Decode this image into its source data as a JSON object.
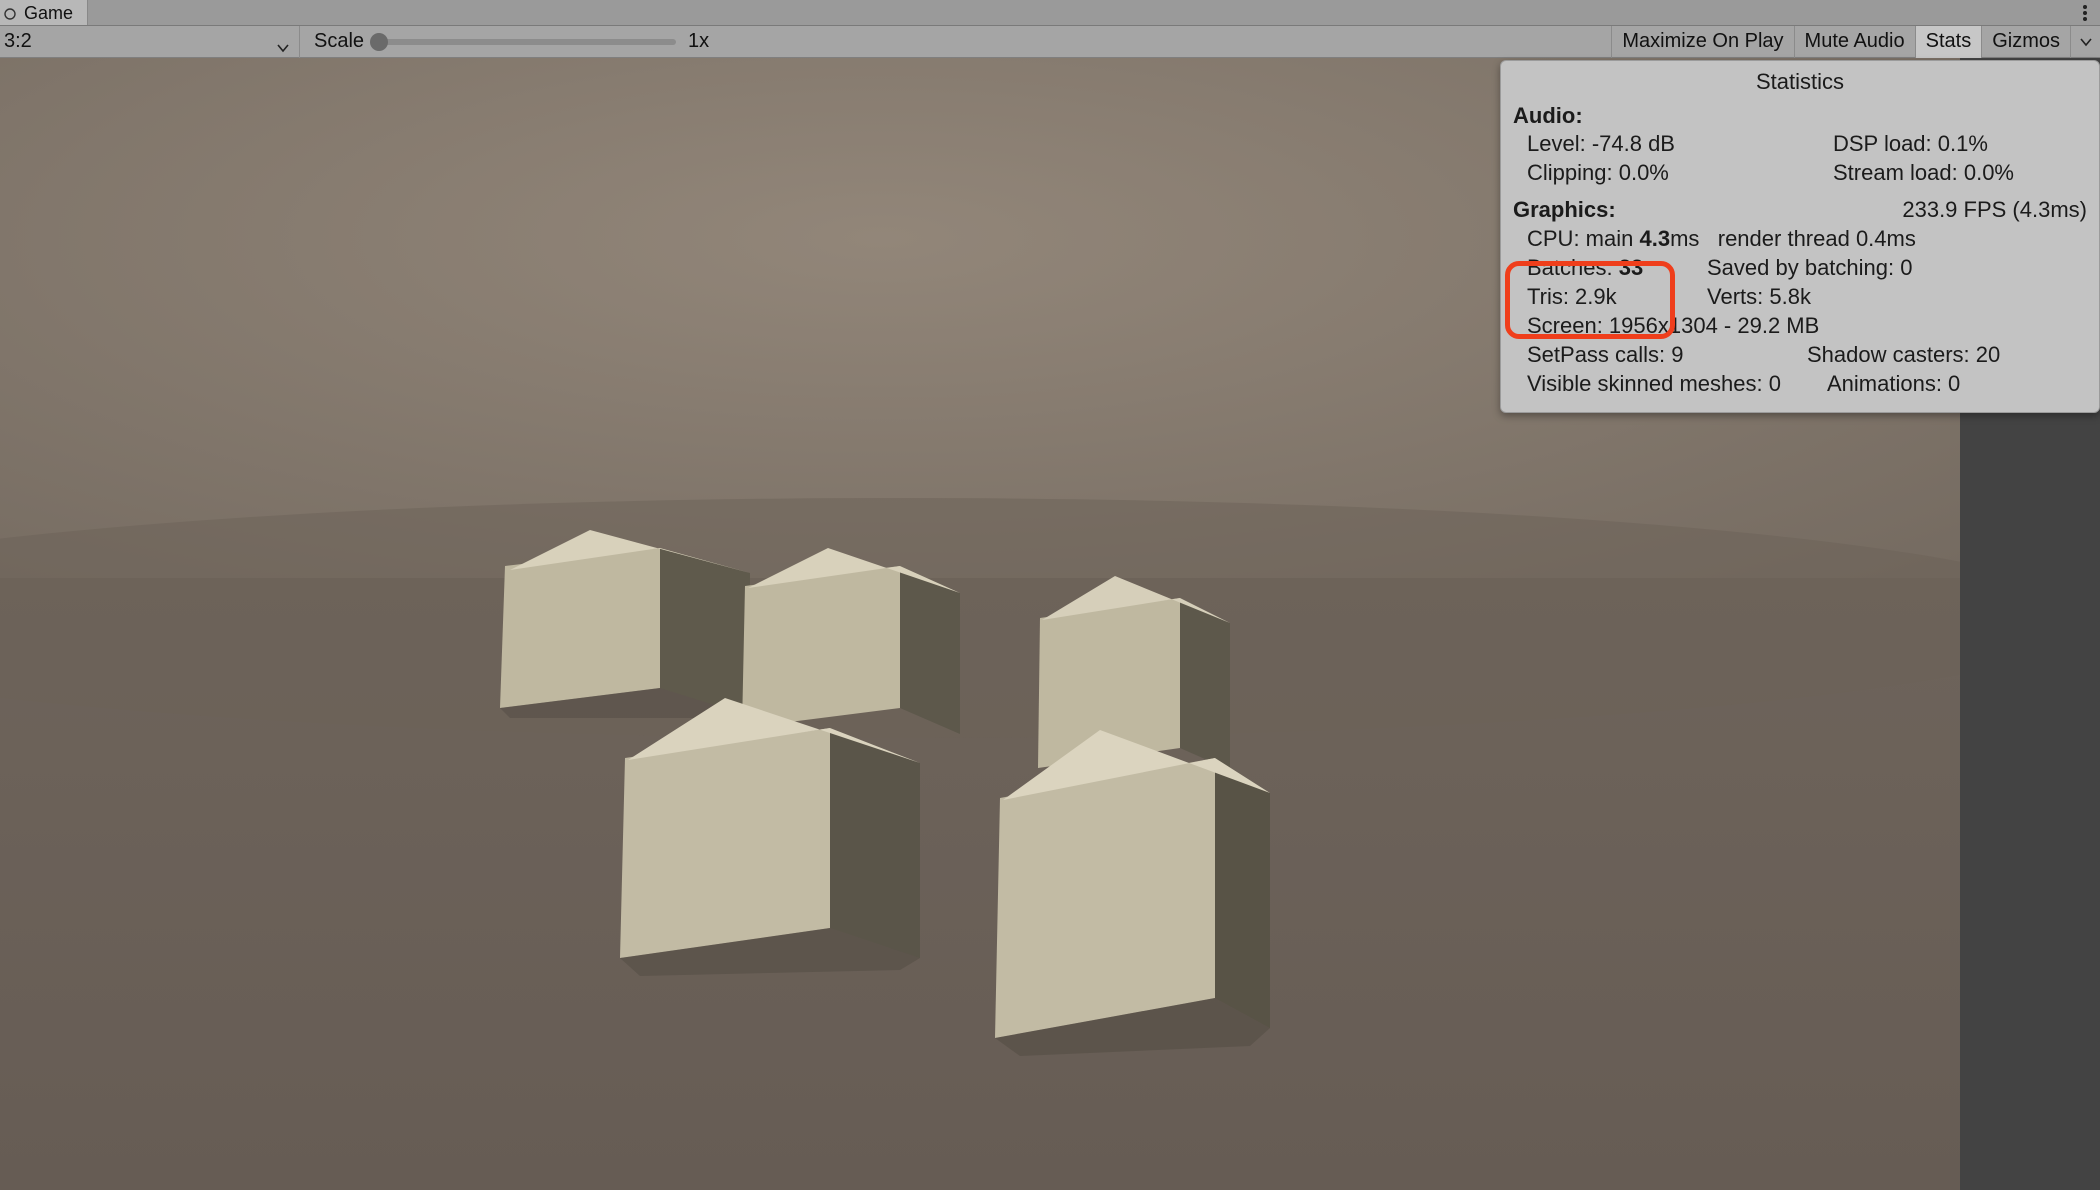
{
  "tab": {
    "label": "Game"
  },
  "toolbar": {
    "aspect": "3:2",
    "scale_label": "Scale",
    "scale_value": "1x",
    "maximize": "Maximize On Play",
    "mute": "Mute Audio",
    "stats": "Stats",
    "gizmos": "Gizmos"
  },
  "stats": {
    "title": "Statistics",
    "audio_head": "Audio:",
    "audio": {
      "level": "Level: -74.8 dB",
      "dsp": "DSP load: 0.1%",
      "clipping": "Clipping: 0.0%",
      "stream": "Stream load: 0.0%"
    },
    "graphics_head": "Graphics:",
    "fps": "233.9 FPS (4.3ms)",
    "cpu_pre": "CPU: main ",
    "cpu_main_bold": "4.3",
    "cpu_post": "ms",
    "render_thread": "render thread 0.4ms",
    "batches_pre": "Batches: ",
    "batches_val": "33",
    "saved": "Saved by batching: 0",
    "tris": "Tris: 2.9k",
    "verts": "Verts: 5.8k",
    "screen": "Screen: 1956x1304 - 29.2 MB",
    "setpass": "SetPass calls: 9",
    "shadow": "Shadow casters: 20",
    "skinned": "Visible skinned meshes: 0",
    "anim": "Animations: 0"
  }
}
